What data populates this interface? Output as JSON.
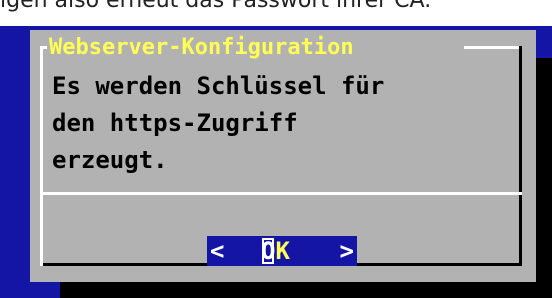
{
  "background_text": "igen also erneut das Passwort ihrer CA.",
  "dialog": {
    "title": "Webserver-Konfiguration",
    "message_lines": [
      "Es werden Schlüssel für",
      "den https-Zugriff",
      "erzeugt."
    ]
  },
  "button": {
    "left_bracket": "<",
    "hotkey": "O",
    "rest": "K",
    "right_bracket": ">"
  },
  "colors": {
    "background": "#1515a5",
    "dialog": "#b2b2b2",
    "title": "#ffff55",
    "button_bg": "#1515a5",
    "button_text": "#ffff55"
  }
}
